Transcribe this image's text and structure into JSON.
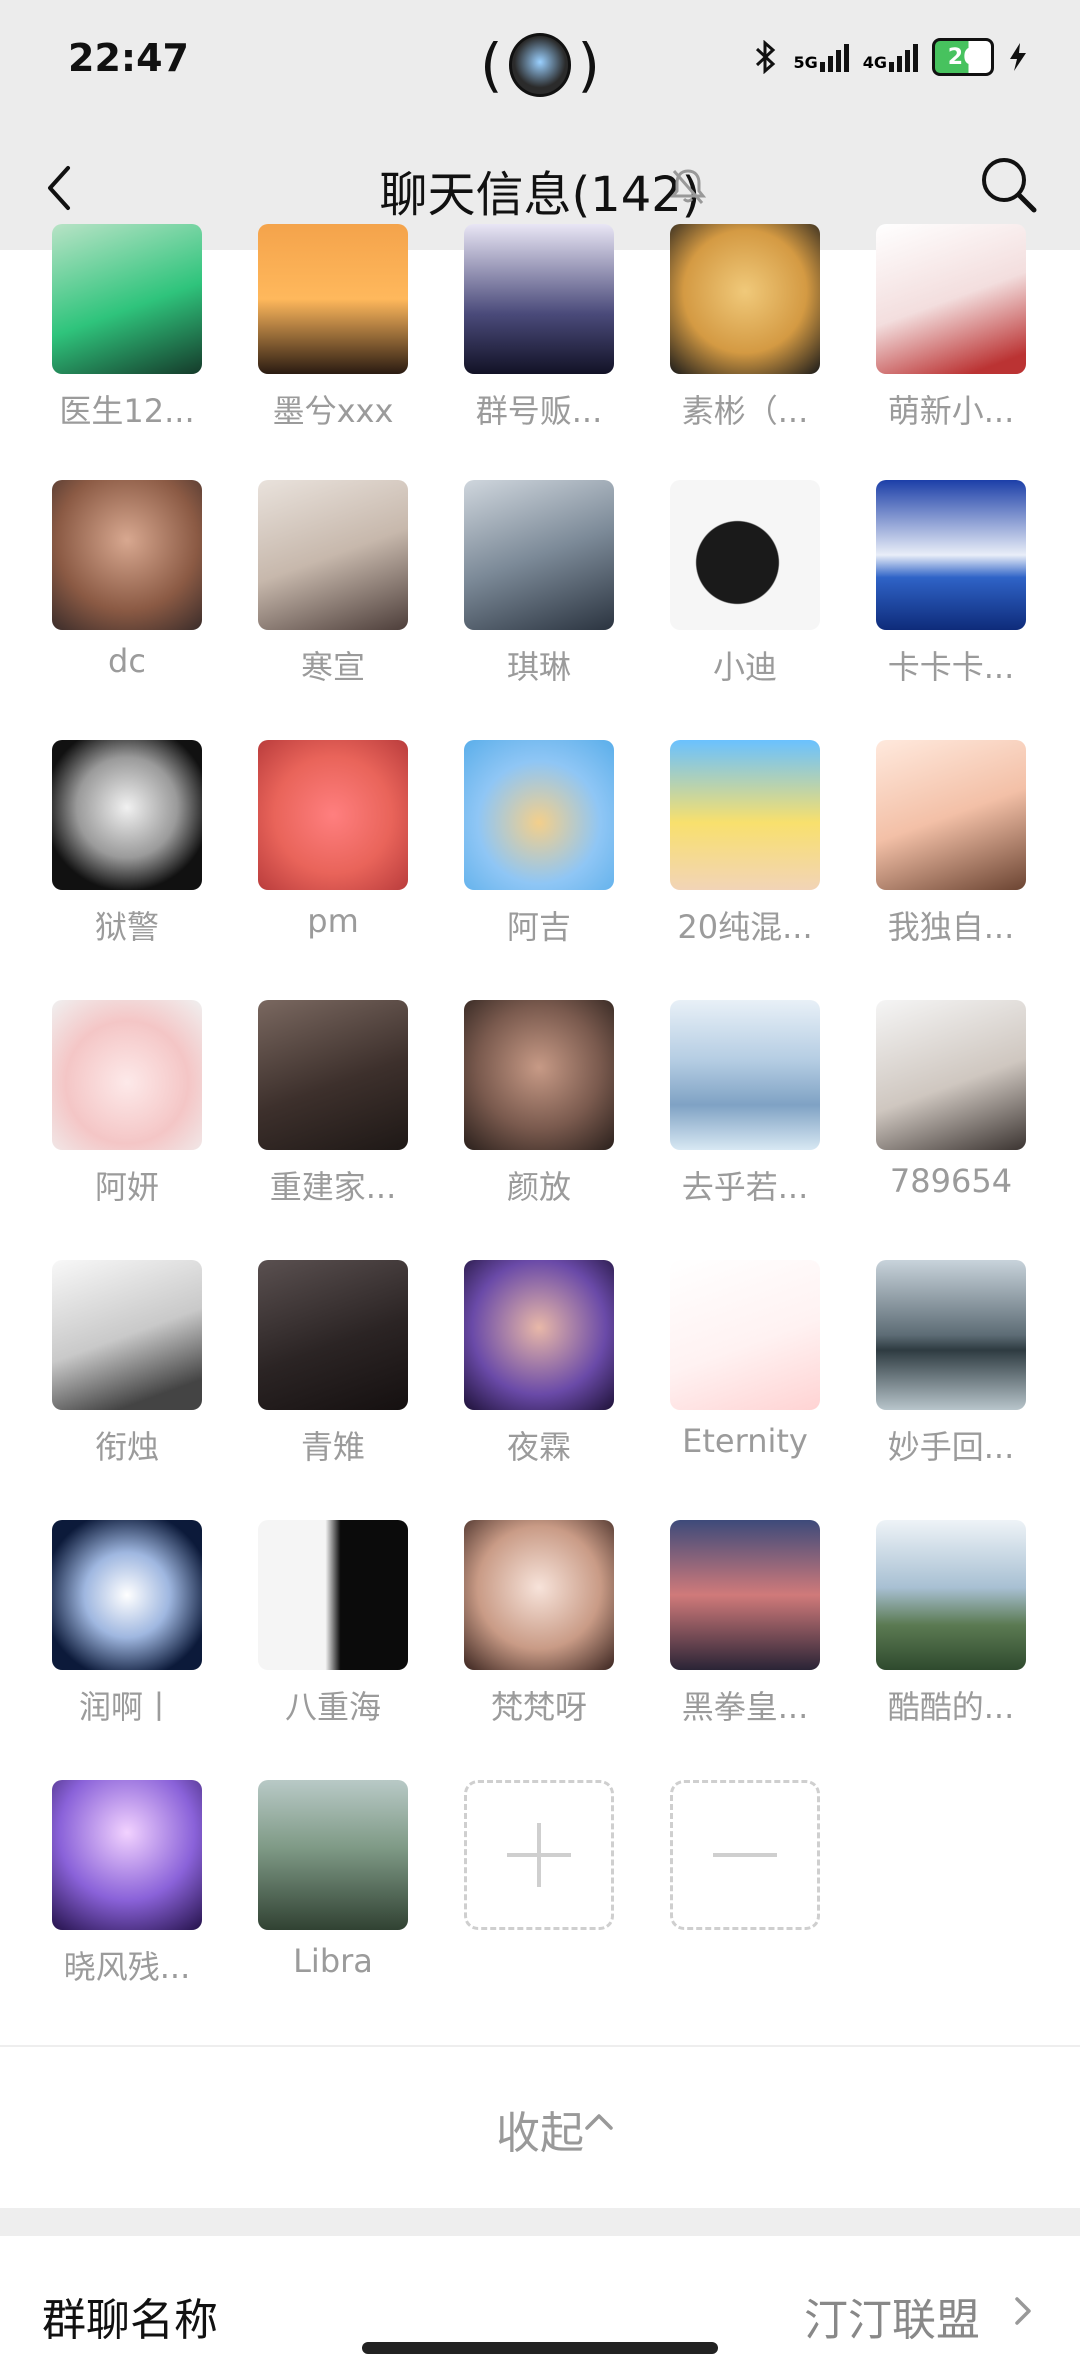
{
  "status_bar": {
    "time": "22:47",
    "network_5g": "5G",
    "network_4g": "4G",
    "battery": "26",
    "icons": [
      "bluetooth-icon",
      "signal-icon",
      "battery-icon",
      "charging-icon"
    ]
  },
  "header": {
    "title": "聊天信息(142)",
    "icons": [
      "back-icon",
      "mute-icon",
      "search-icon"
    ]
  },
  "members": [
    {
      "name": "医生12..."
    },
    {
      "name": "墨兮xxx"
    },
    {
      "name": "群号贩..."
    },
    {
      "name": "素彬（..."
    },
    {
      "name": "萌新小..."
    },
    {
      "name": "dc"
    },
    {
      "name": "寒宣"
    },
    {
      "name": "琪琳"
    },
    {
      "name": "小迪"
    },
    {
      "name": "卡卡卡..."
    },
    {
      "name": "狱警"
    },
    {
      "name": "pm"
    },
    {
      "name": "阿吉"
    },
    {
      "name": "20纯混..."
    },
    {
      "name": "我独自..."
    },
    {
      "name": "阿妍"
    },
    {
      "name": "重建家..."
    },
    {
      "name": "颜放"
    },
    {
      "name": "去乎若..."
    },
    {
      "name": "789654"
    },
    {
      "name": "衔烛"
    },
    {
      "name": "青雉"
    },
    {
      "name": "夜霖"
    },
    {
      "name": "Eternity"
    },
    {
      "name": "妙手回..."
    },
    {
      "name": "润啊丨"
    },
    {
      "name": "八重海"
    },
    {
      "name": "梵梵呀"
    },
    {
      "name": "黑拳皇..."
    },
    {
      "name": "酷酷的..."
    },
    {
      "name": "晓风残..."
    },
    {
      "name": "Libra"
    }
  ],
  "actions": {
    "collapse_label": "收起",
    "add_icon": "plus-icon",
    "remove_icon": "minus-icon"
  },
  "settings": {
    "group_name_label": "群聊名称",
    "group_name_value": "汀汀联盟"
  }
}
